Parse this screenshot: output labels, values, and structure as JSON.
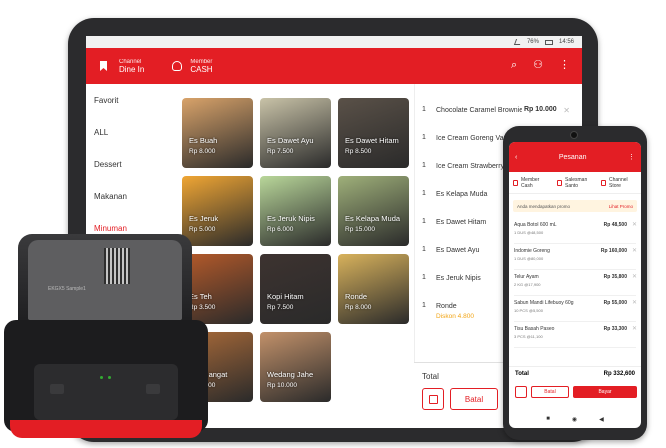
{
  "tablet": {
    "status": {
      "battery": "76%",
      "time": "14:56"
    },
    "header": {
      "channel_caption": "Channel",
      "channel_value": "Dine In",
      "member_caption": "Member",
      "member_value": "CASH"
    },
    "categories": [
      "Favorit",
      "ALL",
      "Dessert",
      "Makanan",
      "Minuman"
    ],
    "products": [
      {
        "name": "Es Buah",
        "price": "Rp 8.000",
        "color": "#d9a36a"
      },
      {
        "name": "Es Dawet Ayu",
        "price": "Rp 7.500",
        "color": "#c9c3a8"
      },
      {
        "name": "Es Dawet Hitam",
        "price": "Rp 8.500",
        "color": "#5a5148"
      },
      {
        "name": "Es Jeruk",
        "price": "Rp 5.000",
        "color": "#f0a634"
      },
      {
        "name": "Es Jeruk Nipis",
        "price": "Rp 6.000",
        "color": "#b9d79a"
      },
      {
        "name": "Es Kelapa Muda",
        "price": "Rp 15.000",
        "color": "#9fb07a"
      },
      {
        "name": "Es Teh",
        "price": "Rp 3.500",
        "color": "#b55a2a"
      },
      {
        "name": "Kopi Hitam",
        "price": "Rp 7.500",
        "color": "#3d3330"
      },
      {
        "name": "Ronde",
        "price": "Rp 8.000",
        "color": "#d8b25c"
      },
      {
        "name": "Teh Hangat",
        "price": "Rp 3.500",
        "color": "#a96a39"
      },
      {
        "name": "Wedang Jahe",
        "price": "Rp 10.000",
        "color": "#c2916a"
      }
    ],
    "order": [
      {
        "qty": "1",
        "name": "Chocolate Caramel Brownies",
        "price": "Rp 10.000"
      },
      {
        "qty": "1",
        "name": "Ice Cream Goreng Vanilla",
        "price": ""
      },
      {
        "qty": "1",
        "name": "Ice Cream Strawberry",
        "price": ""
      },
      {
        "qty": "1",
        "name": "Es Kelapa Muda",
        "price": ""
      },
      {
        "qty": "1",
        "name": "Es Dawet Hitam",
        "price": ""
      },
      {
        "qty": "1",
        "name": "Es Dawet Ayu",
        "price": ""
      },
      {
        "qty": "1",
        "name": "Es Jeruk Nipis",
        "price": ""
      },
      {
        "qty": "1",
        "name": "Ronde",
        "price": "",
        "discount": "Diskon 4.800"
      }
    ],
    "total_label": "Total",
    "cancel_label": "Batal"
  },
  "phone": {
    "title": "Pesanan",
    "member_caption": "Member",
    "member_value": "Cash",
    "sales_caption": "Salesman",
    "sales_value": "Santo",
    "channel_caption": "Channel",
    "channel_value": "Store",
    "promo_text": "Anda mendapatkan promo",
    "promo_link": "Lihat Promo",
    "items": [
      {
        "name": "Aqua Botol 600 mL",
        "detail": "1 DUS @48,500",
        "price": "Rp 48,500"
      },
      {
        "name": "Indomie Goreng",
        "detail": "1 DUS @80,000",
        "price": "Rp 160,000"
      },
      {
        "name": "Telur Ayam",
        "detail": "2 KG @17,900",
        "price": "Rp 35,800"
      },
      {
        "name": "Sabun Mandi Lifebuoy 60g",
        "detail": "10 PCS @5,500",
        "price": "Rp 55,000"
      },
      {
        "name": "Tisu Basah Paseo",
        "detail": "3 PCS @11,100",
        "price": "Rp 33,300"
      }
    ],
    "total_label": "Total",
    "total_value": "Rp 332,600",
    "cancel_label": "Batal",
    "pay_label": "Bayar"
  },
  "printer": {
    "label": "EKGX5 Sample1"
  },
  "colors": {
    "accent": "#e31e24",
    "discount": "#f2a516"
  }
}
